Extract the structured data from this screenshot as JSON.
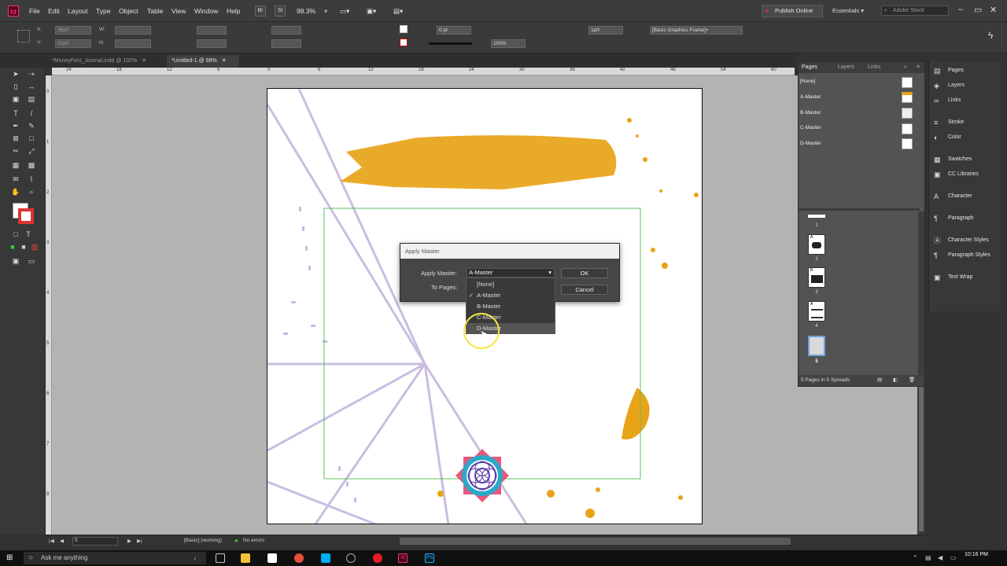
{
  "menu": [
    "File",
    "Edit",
    "Layout",
    "Type",
    "Object",
    "Table",
    "View",
    "Window",
    "Help"
  ],
  "app_icon": "Id",
  "zoom": "98.3%",
  "top_buttons": [
    "Br",
    "St"
  ],
  "publish": "Publish Online",
  "workspace": "Essentials",
  "search_placeholder": "Adobe Stock",
  "control": {
    "x": "36p0",
    "y": "30p0",
    "stroke": "0 pt",
    "opacity": "100%",
    "inset": "1p0",
    "style": "[Basic Graphics Frame]+",
    "x_label": "X:",
    "y_label": "Y:",
    "w_label": "W:",
    "h_label": "H:"
  },
  "tabs": [
    "*MoneyFest_Journal.indd @ 102%",
    "*Untitled-1 @ 98%"
  ],
  "ruler_top": [
    "24",
    "18",
    "12",
    "6",
    "0",
    "6",
    "12",
    "18",
    "24",
    "30",
    "36",
    "42",
    "48",
    "54",
    "60"
  ],
  "ruler_left": [
    "0",
    "1",
    "2",
    "3",
    "4",
    "5",
    "6",
    "7",
    "8"
  ],
  "dialog": {
    "title": "Apply Master",
    "apply_label": "Apply Master:",
    "selected": "A-Master",
    "to_pages_label": "To Pages:",
    "ok": "OK",
    "cancel": "Cancel"
  },
  "dropdown": [
    "[None]",
    "A-Master",
    "B-Master",
    "C-Master",
    "D-Master"
  ],
  "checkmark": "✓",
  "pages_panel": {
    "tabs": [
      "Pages",
      "Layers",
      "Links"
    ],
    "masters": [
      "[None]",
      "A-Master",
      "B-Master",
      "C-Master",
      "D-Master"
    ],
    "page_labels": [
      "A",
      "B",
      "A"
    ],
    "page_numbers": [
      "1",
      "2",
      "3",
      "4",
      "5"
    ],
    "footer": "5 Pages in 5 Spreads"
  },
  "dock": [
    "Pages",
    "Layers",
    "Links",
    "Stroke",
    "Color",
    "Swatches",
    "CC Libraries",
    "Character",
    "Paragraph",
    "Character Styles",
    "Paragraph Styles",
    "Text Wrap"
  ],
  "status": {
    "page": "5",
    "preflight_profile": "[Basic] (working)",
    "errors": "No errors"
  },
  "taskbar": {
    "search": "Ask me anything",
    "time": "10:16 PM",
    "app_labels": [
      "Id",
      "Ps"
    ]
  },
  "colors": {
    "accent_gold": "#e8a317",
    "line_violet": "#b7a9d6",
    "frame_green": "#5fbf5f"
  }
}
